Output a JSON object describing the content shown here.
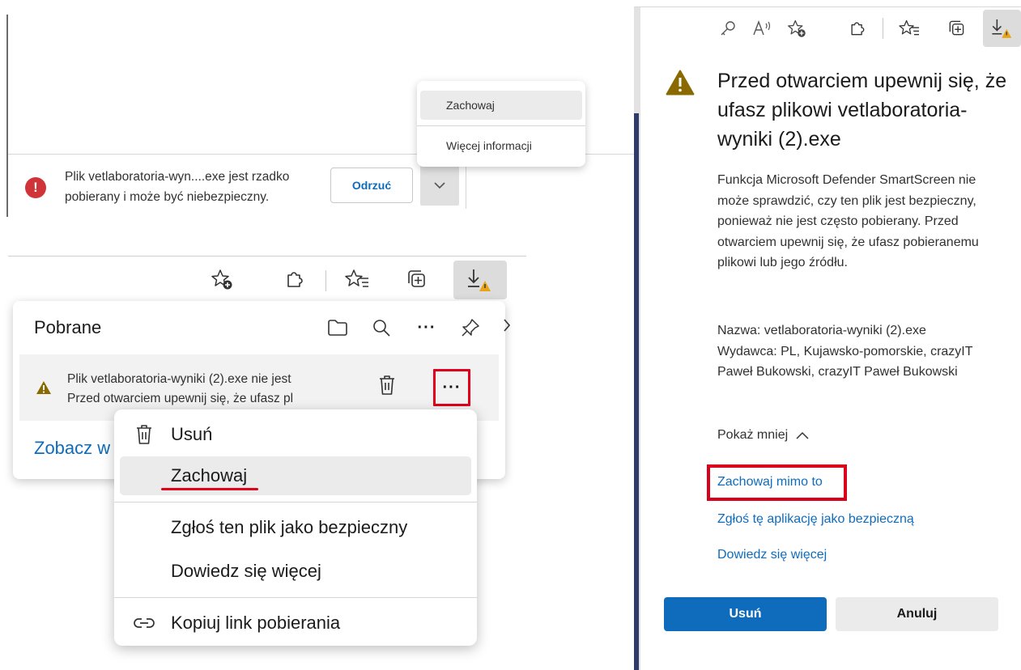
{
  "panel1": {
    "message_line1": "Plik vetlaboratoria-wyn....exe jest rzadko",
    "message_line2": "pobierany i może być niebezpieczny.",
    "error_glyph": "!",
    "discard_label": "Odrzuć",
    "menu": {
      "keep_label": "Zachowaj",
      "more_info_label": "Więcej informacji"
    }
  },
  "panel2": {
    "title": "Pobrane",
    "item_line1": "Plik vetlaboratoria-wyniki (2).exe nie jest",
    "item_line2": "Przed otwarciem upewnij się, że ufasz pl",
    "more_glyph": "···",
    "see_more_link": "Zobacz w",
    "context_menu": {
      "delete_label": "Usuń",
      "keep_label": "Zachowaj",
      "report_safe_label": "Zgłoś ten plik jako bezpieczny",
      "learn_more_label": "Dowiedz się więcej",
      "copy_link_label": "Kopiuj link pobierania"
    }
  },
  "panel3": {
    "title": "Przed otwarciem upewnij się, że ufasz plikowi vetlaboratoria-wyniki (2).exe",
    "body": "Funkcja Microsoft Defender SmartScreen nie może sprawdzić, czy ten plik jest bezpieczny, ponieważ nie jest często pobierany. Przed otwarciem upewnij się, że ufasz pobieranemu plikowi lub jego źródłu.",
    "name_line": "Nazwa: vetlaboratoria-wyniki (2).exe",
    "publisher_line": "Wydawca: PL, Kujawsko-pomorskie, crazyIT Paweł Bukowski, crazyIT Paweł Bukowski",
    "show_less_label": "Pokaż mniej",
    "keep_anyway_link": "Zachowaj mimo to",
    "report_app_link": "Zgłoś tę aplikację jako bezpieczną",
    "learn_more_link": "Dowiedz się więcej",
    "delete_button": "Usuń",
    "cancel_button": "Anuluj"
  },
  "colors": {
    "accent_blue": "#0f6cbd",
    "highlight_red": "#e0001b",
    "error_red": "#d13438",
    "warning_gold": "#c19c00"
  },
  "icons": [
    "error-icon",
    "chevron-down-icon",
    "add-favorite-icon",
    "extensions-icon",
    "favorites-icon",
    "collections-icon",
    "download-warning-icon",
    "folder-icon",
    "search-icon",
    "more-icon",
    "pin-icon",
    "chevron-right-icon",
    "warning-icon",
    "trash-icon",
    "link-icon",
    "key-icon",
    "read-aloud-icon",
    "chevron-up-icon"
  ]
}
